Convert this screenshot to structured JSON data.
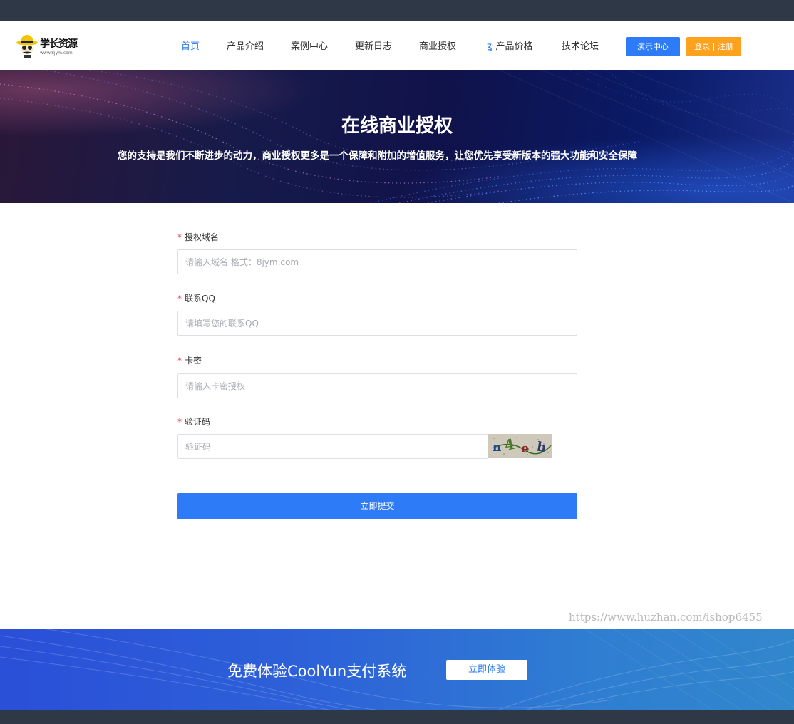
{
  "brand": {
    "name": "学长资源",
    "url": "www.8jym.com"
  },
  "nav": {
    "items": [
      {
        "label": "首页",
        "active": true
      },
      {
        "label": "产品介绍"
      },
      {
        "label": "案例中心"
      },
      {
        "label": "更新日志"
      },
      {
        "label": "商业授权"
      },
      {
        "label": "产品价格",
        "icon": "price-tag-icon"
      },
      {
        "label": "技术论坛"
      }
    ],
    "demo_button": "演示中心",
    "login_button": "登录 | 注册"
  },
  "hero": {
    "title": "在线商业授权",
    "subtitle": "您的支持是我们不断进步的动力，商业授权更多是一个保障和附加的增值服务，让您优先享受新版本的强大功能和安全保障"
  },
  "form": {
    "fields": [
      {
        "label": "授权域名",
        "placeholder": "请输入域名 格式：8jym.com",
        "value": ""
      },
      {
        "label": "联系QQ",
        "placeholder": "请填写您的联系QQ",
        "value": ""
      },
      {
        "label": "卡密",
        "placeholder": "请输入卡密授权",
        "value": ""
      },
      {
        "label": "验证码",
        "placeholder": "验证码",
        "value": ""
      }
    ],
    "captcha_text": "n4eb",
    "submit_label": "立即提交"
  },
  "watermark": "https://www.huzhan.com/ishop6455",
  "cta": {
    "text": "免费体验CoolYun支付系统",
    "button": "立即体验"
  },
  "colors": {
    "primary": "#2d7bf6",
    "accent": "#fea11c",
    "topbar": "#2f3846"
  }
}
